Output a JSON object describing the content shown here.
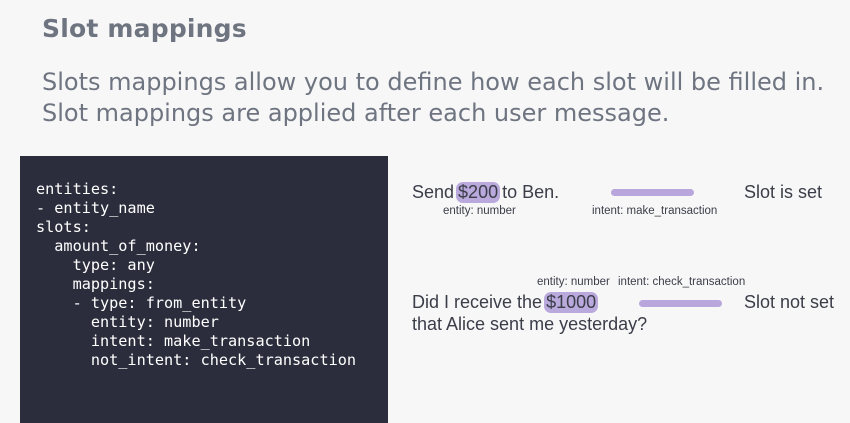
{
  "title": "Slot mappings",
  "subtitle": {
    "line1": "Slots mappings allow you to define how each slot will be filled in.",
    "line2": "Slot mappings are applied after each user message."
  },
  "code": "entities:\n- entity_name\nslots:\n  amount_of_money:\n    type: any\n    mappings:\n    - type: from_entity\n      entity: number\n      intent: make_transaction\n      not_intent: check_transaction",
  "example1": {
    "before": "Send",
    "highlight": "$200",
    "after": "to Ben.",
    "entity_label": "entity: number",
    "intent_label": "intent: make_transaction",
    "result": "Slot is set"
  },
  "example2": {
    "before": "Did I receive the",
    "highlight": "$1000",
    "line2": "that Alice sent me yesterday?",
    "entity_label": "entity: number",
    "intent_label": "intent: check_transaction",
    "result": "Slot not set"
  },
  "colors": {
    "highlight": "#b9a9dc",
    "code_bg": "#2b2d3c",
    "heading": "#6e7480"
  }
}
